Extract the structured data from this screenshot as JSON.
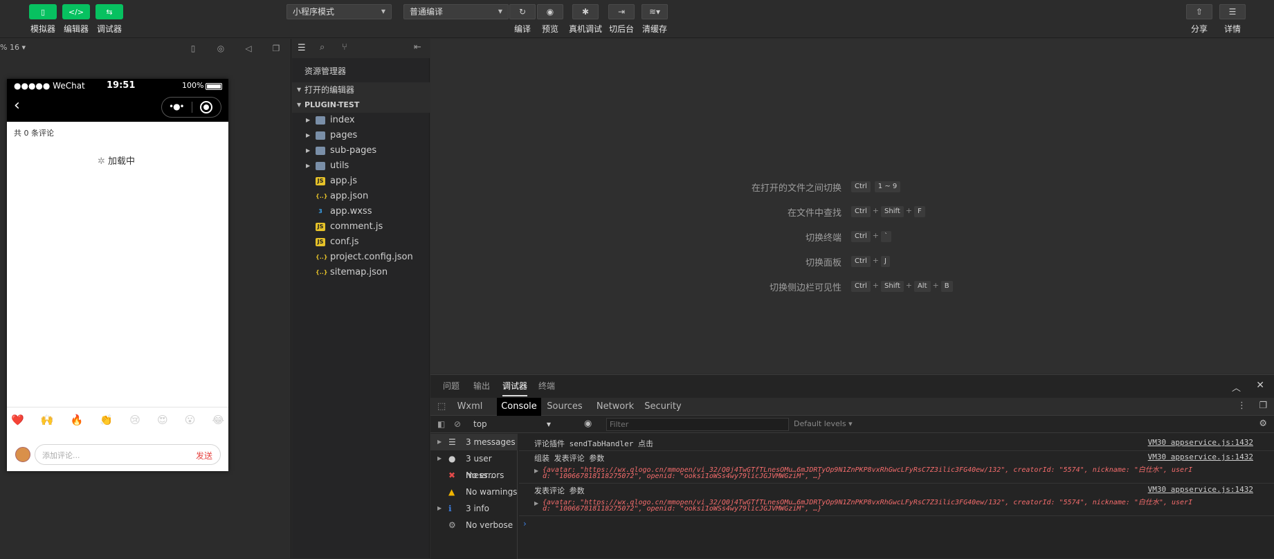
{
  "toolbar": {
    "simulator_label": "模拟器",
    "editor_label": "编辑器",
    "debugger_label": "调试器",
    "mode_select": "小程序模式",
    "compile_select": "普通编译",
    "compile_label": "编译",
    "preview_label": "预览",
    "real_debug_label": "真机调试",
    "background_label": "切后台",
    "clear_cache_label": "清缓存",
    "share_label": "分享",
    "details_label": "详情"
  },
  "simulator": {
    "zoom": "% 16",
    "status_left": "●●●●● WeChat",
    "status_time": "19:51",
    "status_battery": "100%",
    "comment_count": "共 0 条评论",
    "loading_text": "加载中",
    "emojis": [
      "❤️",
      "🙌",
      "🔥",
      "👏",
      "😢",
      "😍",
      "😮",
      "😂"
    ],
    "comment_placeholder": "添加评论...",
    "send_label": "发送"
  },
  "explorer": {
    "title": "资源管理器",
    "open_editors": "打开的编辑器",
    "project": "PLUGIN-TEST",
    "items": [
      {
        "name": "index",
        "type": "folder"
      },
      {
        "name": "pages",
        "type": "folder"
      },
      {
        "name": "sub-pages",
        "type": "folder"
      },
      {
        "name": "utils",
        "type": "folder"
      },
      {
        "name": "app.js",
        "type": "js"
      },
      {
        "name": "app.json",
        "type": "json"
      },
      {
        "name": "app.wxss",
        "type": "wxss"
      },
      {
        "name": "comment.js",
        "type": "js"
      },
      {
        "name": "conf.js",
        "type": "js"
      },
      {
        "name": "project.config.json",
        "type": "json"
      },
      {
        "name": "sitemap.json",
        "type": "json"
      }
    ]
  },
  "shortcuts": [
    {
      "label": "在打开的文件之间切换",
      "keys": [
        "Ctrl",
        "1 ~ 9"
      ]
    },
    {
      "label": "在文件中查找",
      "keys": [
        "Ctrl",
        "+",
        "Shift",
        "+",
        "F"
      ]
    },
    {
      "label": "切换终端",
      "keys": [
        "Ctrl",
        "+",
        "`"
      ]
    },
    {
      "label": "切换面板",
      "keys": [
        "Ctrl",
        "+",
        "J"
      ]
    },
    {
      "label": "切换侧边栏可见性",
      "keys": [
        "Ctrl",
        "+",
        "Shift",
        "+",
        "Alt",
        "+",
        "B"
      ]
    }
  ],
  "debug": {
    "tabs": [
      "问题",
      "输出",
      "调试器",
      "终端"
    ],
    "active_tab": "调试器",
    "devtools_tabs": [
      "Wxml",
      "Console",
      "Sources",
      "Network",
      "Security"
    ],
    "active_devtools_tab": "Console",
    "context": "top",
    "filter_placeholder": "Filter",
    "levels": "Default levels",
    "sidebar": [
      {
        "label": "3 messages",
        "icon": "list-icon"
      },
      {
        "label": "3 user mess...",
        "icon": "user-icon"
      },
      {
        "label": "No errors",
        "icon": "error-icon"
      },
      {
        "label": "No warnings",
        "icon": "warning-icon"
      },
      {
        "label": "3 info",
        "icon": "info-icon"
      },
      {
        "label": "No verbose",
        "icon": "gear-icon"
      }
    ],
    "logs": [
      {
        "title": "评论插件 sendTabHandler 点击",
        "source": "VM30 appservice.js:1432",
        "detail1": "",
        "detail2": ""
      },
      {
        "title": "组装 发表评论 参数",
        "source": "VM30 appservice.js:1432",
        "detail1": "{avatar: \"https://wx.qlogo.cn/mmopen/vi_32/Q0j4TwGTfTLnesOMu…6mJDRTyOp9N1ZnPKP8vxRhGwcLFyRsC7Z3ilic3FG40ew/132\", creatorId: \"5574\", nickname: \"白仕水\", userI",
        "detail2": "d: \"100667818118275072\", openid: \"ooksi1oWSs4wy79licJGJVMWGziM\", …}"
      },
      {
        "title": "发表评论 参数",
        "source": "VM30 appservice.js:1432",
        "detail1": "{avatar: \"https://wx.qlogo.cn/mmopen/vi_32/Q0j4TwGTfTLnesOMu…6mJDRTyOp9N1ZnPKP8vxRhGwcLFyRsC7Z3ilic3FG40ew/132\", creatorId: \"5574\", nickname: \"白仕水\", userI",
        "detail2": "d: \"100667818118275072\", openid: \"ooksi1oWSs4wy79licJGJVMWGziM\", …}"
      }
    ]
  }
}
